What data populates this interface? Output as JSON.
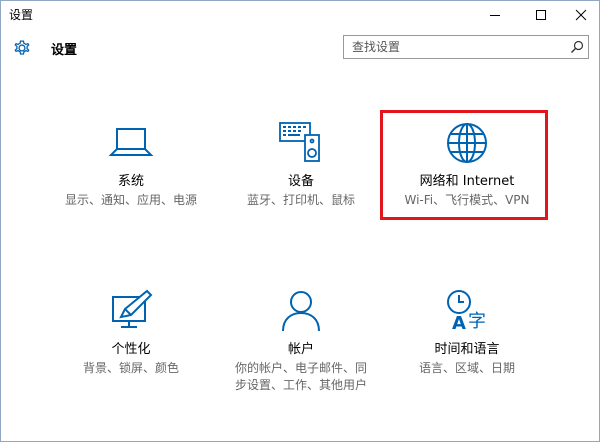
{
  "window": {
    "title": "设置"
  },
  "header": {
    "page_title": "设置",
    "search": {
      "placeholder": "查找设置",
      "value": ""
    }
  },
  "tiles": [
    {
      "name": "系统",
      "desc": "显示、通知、应用、电源",
      "icon": "laptop-icon"
    },
    {
      "name": "设备",
      "desc": "蓝牙、打印机、鼠标",
      "icon": "devices-icon"
    },
    {
      "name": "网络和 Internet",
      "desc": "Wi-Fi、飞行模式、VPN",
      "icon": "globe-icon"
    },
    {
      "name": "个性化",
      "desc": "背景、锁屏、颜色",
      "icon": "personalization-icon"
    },
    {
      "name": "帐户",
      "desc": "你的帐户、电子邮件、同步设置、工作、其他用户",
      "icon": "person-icon"
    },
    {
      "name": "时间和语言",
      "desc": "语言、区域、日期",
      "icon": "time-language-icon"
    }
  ],
  "colors": {
    "accent": "#0063b1",
    "highlight": "#e0161c"
  }
}
